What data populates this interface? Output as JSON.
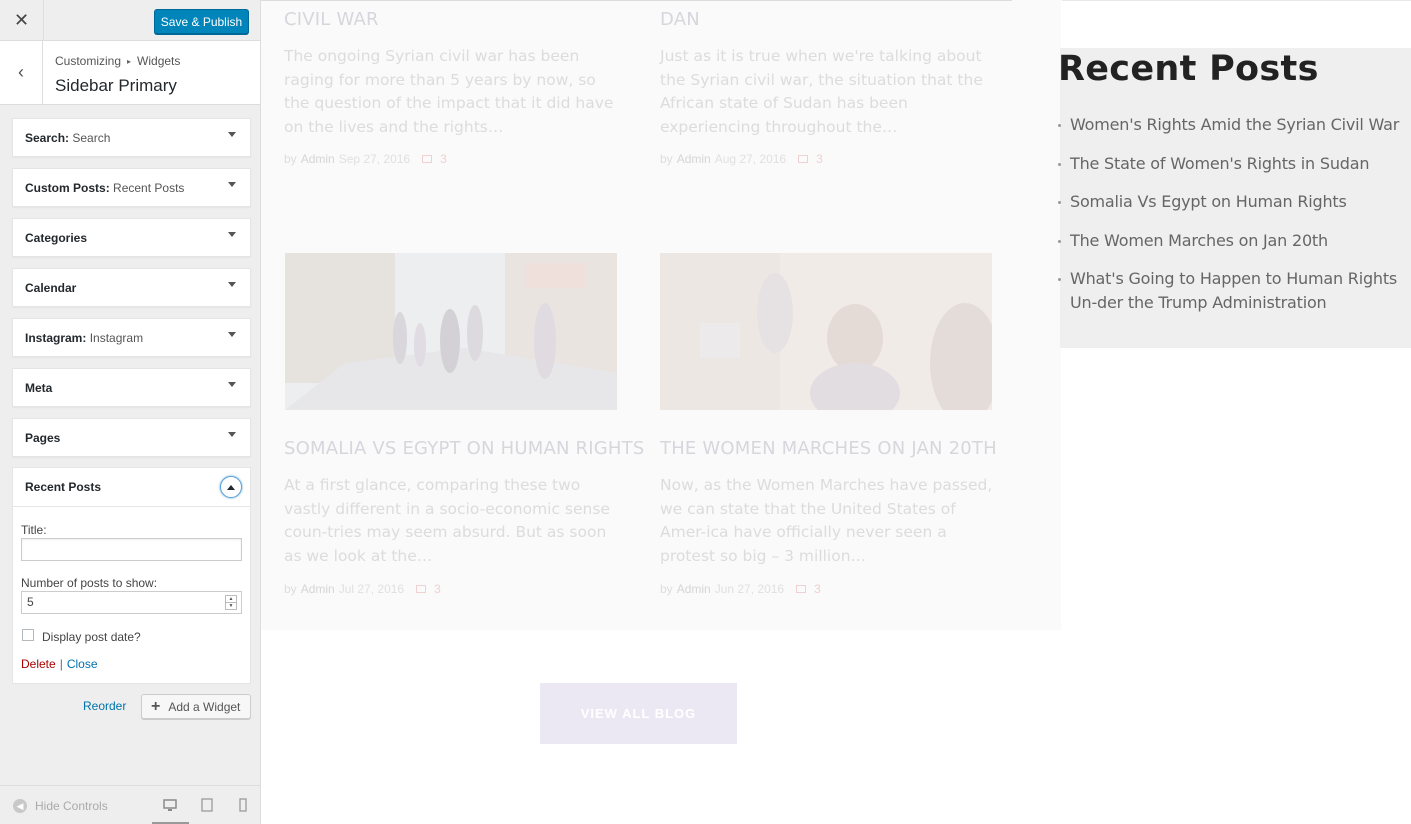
{
  "header": {
    "close_symbol": "✕",
    "publish_label": "Save & Publish"
  },
  "panel": {
    "back_symbol": "‹",
    "breadcrumb_root": "Customizing",
    "breadcrumb_sep": "▸",
    "breadcrumb_child": "Widgets",
    "title": "Sidebar Primary"
  },
  "widgets": [
    {
      "name": "Search",
      "sub": "Search"
    },
    {
      "name": "Custom Posts",
      "sub": "Recent Posts"
    },
    {
      "name": "Categories",
      "sub": ""
    },
    {
      "name": "Calendar",
      "sub": ""
    },
    {
      "name": "Instagram",
      "sub": "Instagram"
    },
    {
      "name": "Meta",
      "sub": ""
    },
    {
      "name": "Pages",
      "sub": ""
    }
  ],
  "recent_widget": {
    "name": "Recent Posts",
    "title_label": "Title:",
    "title_value": "",
    "count_label": "Number of posts to show:",
    "count_value": "5",
    "date_label": "Display post date?",
    "date_checked": false,
    "delete_label": "Delete",
    "pipe": "|",
    "close_label": "Close"
  },
  "actions": {
    "reorder_label": "Reorder",
    "add_widget_label": "Add a Widget"
  },
  "footer": {
    "hide_controls_label": "Hide Controls"
  },
  "preview": {
    "posts": [
      {
        "title": "CIVIL WAR",
        "excerpt": "The ongoing Syrian civil war has been raging for more than 5 years by now, so the question of the impact that it did have on the lives and the rights…",
        "by": "by",
        "author": "Admin",
        "date": "Sep 27, 2016",
        "comments": "3"
      },
      {
        "title": "DAN",
        "excerpt": "Just as it is true when we're talking about the Syrian civil war, the situation that the African state of Sudan has been experiencing throughout the…",
        "by": "by",
        "author": "Admin",
        "date": "Aug 27, 2016",
        "comments": "3"
      },
      {
        "title": "SOMALIA VS EGYPT ON HUMAN RIGHTS",
        "excerpt": "At a first glance, comparing these two vastly different in a socio-economic sense coun-tries may seem absurd. But as soon as we look at the…",
        "by": "by",
        "author": "Admin",
        "date": "Jul 27, 2016",
        "comments": "3"
      },
      {
        "title": "THE WOMEN MARCHES ON JAN 20TH",
        "excerpt": "Now, as the Women Marches have passed, we can state that the United States of Amer-ica have officially never seen a protest so big – 3 million…",
        "by": "by",
        "author": "Admin",
        "date": "Jun 27, 2016",
        "comments": "3"
      }
    ],
    "view_all_label": "VIEW ALL BLOG",
    "recent_posts_heading": "Recent Posts",
    "recent_posts": [
      "Women's Rights Amid the Syrian Civil War",
      "The State of Women's Rights in Sudan",
      "Somalia Vs Egypt on Human Rights",
      "The Women Marches on Jan 20th",
      "What's Going to Happen to Human Rights Un-der the Trump Administration"
    ]
  },
  "colors": {
    "primary_button": "#0085ba",
    "link": "#0073aa",
    "delete": "#aa0000",
    "sidebar_bg": "#eeeeee"
  },
  "icons": {
    "close": "close-icon",
    "back": "back-arrow-icon",
    "plus": "plus-icon",
    "hide_controls": "collapse-circle-icon",
    "devices": [
      "desktop-icon",
      "tablet-icon",
      "mobile-icon"
    ]
  }
}
